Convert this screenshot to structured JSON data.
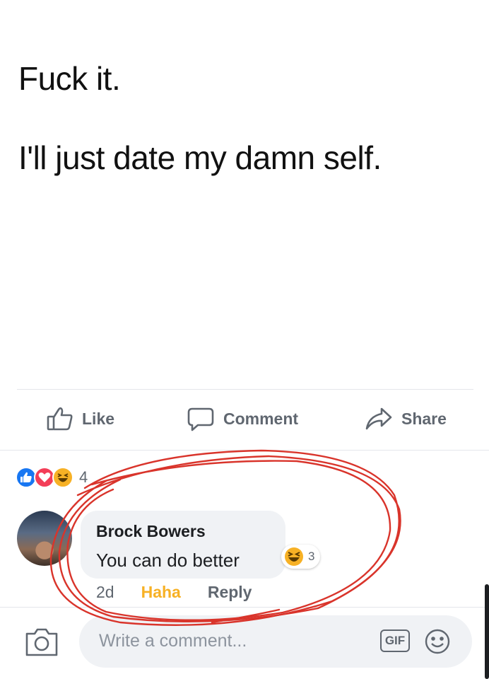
{
  "post": {
    "line1": "Fuck it.",
    "line2": "I'll just date my damn self."
  },
  "actions": {
    "like": "Like",
    "comment": "Comment",
    "share": "Share"
  },
  "reactions": {
    "icons": [
      "like-icon",
      "love-icon",
      "haha-icon"
    ],
    "count": "4"
  },
  "comment": {
    "author": "Brock Bowers",
    "text": "You can do better",
    "reaction_icon": "haha-icon",
    "reaction_count": "3",
    "time": "2d",
    "haha_label": "Haha",
    "reply_label": "Reply"
  },
  "composer": {
    "placeholder": "Write a comment...",
    "gif_label": "GIF"
  },
  "colors": {
    "facebook_blue": "#1877f2",
    "love_red": "#f33e58",
    "haha_yellow": "#f7b125",
    "annotation_red": "#d9342b"
  }
}
